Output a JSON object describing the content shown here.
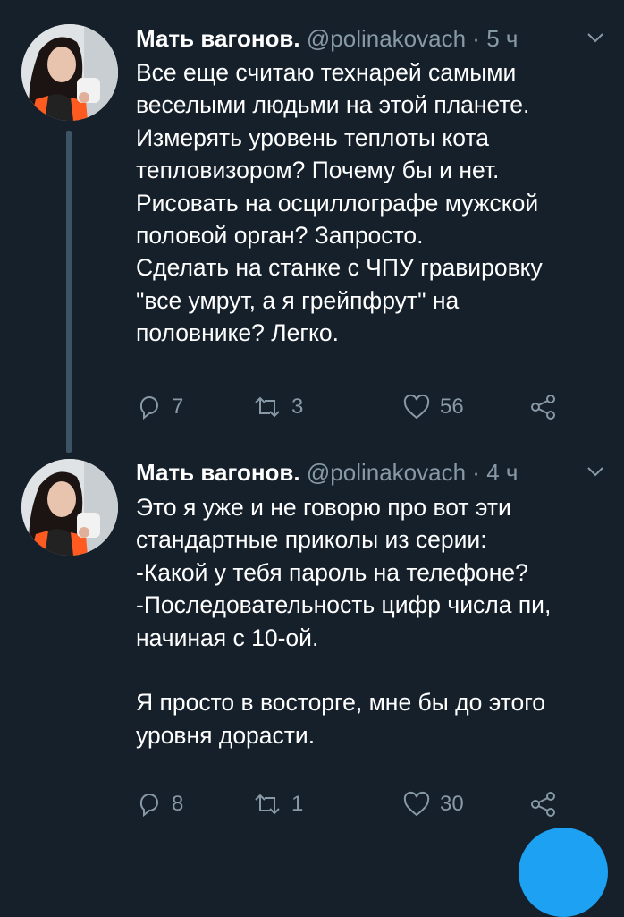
{
  "colors": {
    "background": "#15202b",
    "text_primary": "#ffffff",
    "text_secondary": "#8899a6",
    "thread_line": "#3d5466",
    "accent": "#1da1f2"
  },
  "tweets": [
    {
      "author_name": "Мать вагонов.",
      "handle": "@polinakovach",
      "separator": "·",
      "time": "5 ч",
      "text": "Все еще считаю технарей самыми\nвеселыми людьми на этой планете.\nИзмерять уровень теплоты кота\nтепловизором? Почему бы и нет.\nРисовать на осциллографе мужской\nполовой орган? Запросто.\nСделать на станке с ЧПУ гравировку\n\"все умрут, а я грейпфрут\" на\nполовнике? Легко.",
      "replies": "7",
      "retweets": "3",
      "likes": "56",
      "icons": [
        "avatar-photo",
        "chevron-down-icon",
        "reply-icon",
        "retweet-icon",
        "like-icon",
        "share-icon"
      ]
    },
    {
      "author_name": "Мать вагонов.",
      "handle": "@polinakovach",
      "separator": "·",
      "time": "4 ч",
      "text": "Это я уже и не говорю про вот эти\nстандартные приколы из серии:\n-Какой у тебя пароль на телефоне?\n-Последовательность цифр числа пи,\nначиная с 10-ой.\n\nЯ просто в восторге, мне бы до этого\nуровня дорасти.",
      "replies": "8",
      "retweets": "1",
      "likes": "30",
      "icons": [
        "avatar-photo",
        "chevron-down-icon",
        "reply-icon",
        "retweet-icon",
        "like-icon",
        "share-icon"
      ]
    }
  ],
  "compose_fab": {
    "icon": "compose-icon"
  }
}
